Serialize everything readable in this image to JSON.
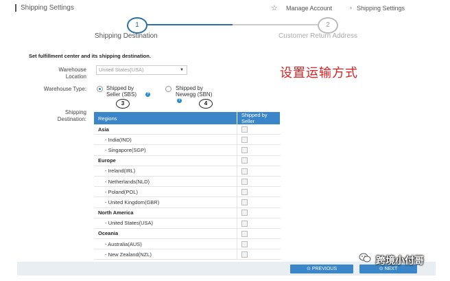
{
  "header": {
    "page_title": "Shipping Settings",
    "breadcrumb": {
      "manage_account": "Manage Account",
      "separator": "›",
      "current": "Shipping Settings"
    }
  },
  "steps": [
    {
      "number": "1",
      "label": "Shipping Destination",
      "active": true
    },
    {
      "number": "2",
      "label": "Customer Return Address",
      "active": false
    }
  ],
  "form": {
    "section_title": "Set fulfillment center and its shipping destination.",
    "warehouse_location_label": "Warehouse Location",
    "warehouse_location_value": "United States(USA)",
    "warehouse_type_label": "Warehouse Type:",
    "type_options": [
      {
        "label": "Shipped by Seller (SBS)",
        "selected": true
      },
      {
        "label": "Shipped by Newegg (SBN)",
        "selected": false
      }
    ],
    "shipping_destination_label": "Shipping Destination:"
  },
  "annotations": {
    "sbs": "3",
    "sbn": "4",
    "chinese_caption": "设置运输方式"
  },
  "table": {
    "columns": [
      "Regions",
      "Shipped by Seller"
    ],
    "rows": [
      {
        "kind": "region",
        "name": "Asia"
      },
      {
        "kind": "country",
        "name": "- India(IND)"
      },
      {
        "kind": "country",
        "name": "- Singapore(SGP)"
      },
      {
        "kind": "region",
        "name": "Europe"
      },
      {
        "kind": "country",
        "name": "- Ireland(IRL)"
      },
      {
        "kind": "country",
        "name": "- Netherlands(NLD)"
      },
      {
        "kind": "country",
        "name": "- Poland(POL)"
      },
      {
        "kind": "country",
        "name": "- United Kingdom(GBR)"
      },
      {
        "kind": "region",
        "name": "North America"
      },
      {
        "kind": "country",
        "name": "- United States(USA)"
      },
      {
        "kind": "region",
        "name": "Oceania"
      },
      {
        "kind": "country",
        "name": "- Australia(AUS)"
      },
      {
        "kind": "country",
        "name": "- New Zealand(NZL)"
      }
    ]
  },
  "footer": {
    "previous": "PREVIOUS",
    "next": "NEXT"
  },
  "watermark": {
    "text": "跨境小付哥"
  },
  "colors": {
    "accent": "#3a86c8",
    "caption_red": "#e02020",
    "step_active": "#2a6fa8",
    "step_inactive": "#cccccc"
  }
}
